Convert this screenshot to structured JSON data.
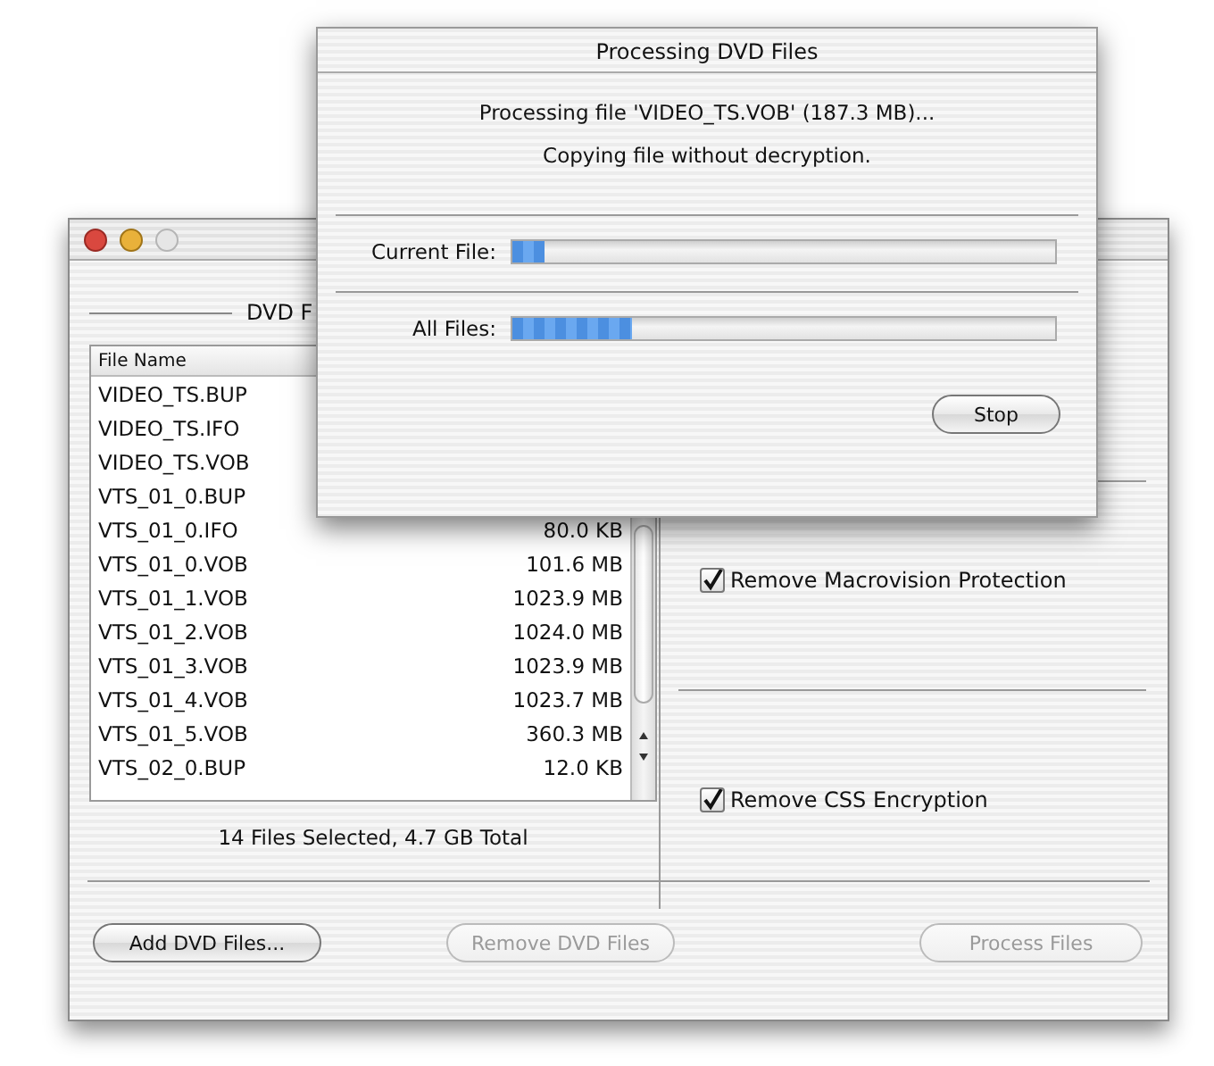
{
  "main_window": {
    "group_title": "DVD F",
    "table": {
      "columns": [
        "File Name"
      ],
      "rows": [
        {
          "name": "VIDEO_TS.BUP"
        },
        {
          "name": "VIDEO_TS.IFO"
        },
        {
          "name": "VIDEO_TS.VOB"
        },
        {
          "name": "VTS_01_0.BUP"
        },
        {
          "name": "VTS_01_0.IFO",
          "size": "80.0 KB"
        },
        {
          "name": "VTS_01_0.VOB",
          "size": "101.6 MB"
        },
        {
          "name": "VTS_01_1.VOB",
          "size": "1023.9 MB"
        },
        {
          "name": "VTS_01_2.VOB",
          "size": "1024.0 MB"
        },
        {
          "name": "VTS_01_3.VOB",
          "size": "1023.9 MB"
        },
        {
          "name": "VTS_01_4.VOB",
          "size": "1023.7 MB"
        },
        {
          "name": "VTS_01_5.VOB",
          "size": "360.3 MB"
        },
        {
          "name": "VTS_02_0.BUP",
          "size": "12.0 KB"
        }
      ]
    },
    "summary": "14 Files Selected, 4.7 GB Total",
    "options": [
      {
        "label": "Remove Macrovision Protection",
        "checked": true
      },
      {
        "label": "Remove CSS Encryption",
        "checked": true
      }
    ],
    "buttons": [
      {
        "label": "Add DVD Files...",
        "disabled": false
      },
      {
        "label": "Remove DVD Files",
        "disabled": true
      },
      {
        "label": "Process Files",
        "disabled": true
      }
    ]
  },
  "dialog": {
    "title": "Processing DVD Files",
    "messages": [
      "Processing file 'VIDEO_TS.VOB' (187.3 MB)...",
      "Copying file without decryption."
    ],
    "progress": [
      {
        "label": "Current File:",
        "level": 0.06
      },
      {
        "label": "All Files:",
        "level": 0.22
      }
    ],
    "buttons": [
      {
        "label": "Stop",
        "disabled": false
      }
    ]
  }
}
